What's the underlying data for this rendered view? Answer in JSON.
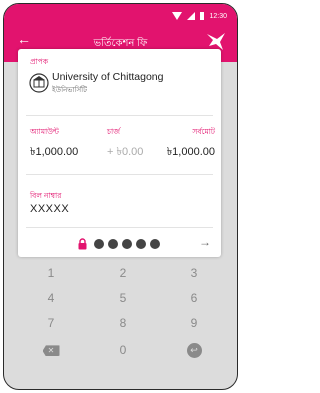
{
  "status_bar": {
    "time": "12:30"
  },
  "header": {
    "title": "ভর্তিকেশন ফি"
  },
  "card": {
    "recipient_label": "প্রাপক",
    "recipient_name": "University of Chittagong",
    "recipient_sub": "ইউনিভার্সিটি",
    "amount": {
      "label": "অ্যামাউন্ট",
      "value": "৳1,000.00"
    },
    "charge": {
      "label": "চার্জ",
      "value": "+ ৳0.00"
    },
    "total": {
      "label": "সর্বমোট",
      "value": "৳1,000.00"
    },
    "bill_label": "বিল নাম্বার",
    "bill_value": "XXXXX",
    "pin_dots": 5
  },
  "keypad": {
    "keys": [
      "1",
      "2",
      "3",
      "4",
      "5",
      "6",
      "7",
      "8",
      "9",
      "0"
    ],
    "delete_symbol": "✕",
    "enter_symbol": "↩"
  },
  "colors": {
    "brand": "#e2136e",
    "keypad_bg": "#dcdcdc"
  }
}
